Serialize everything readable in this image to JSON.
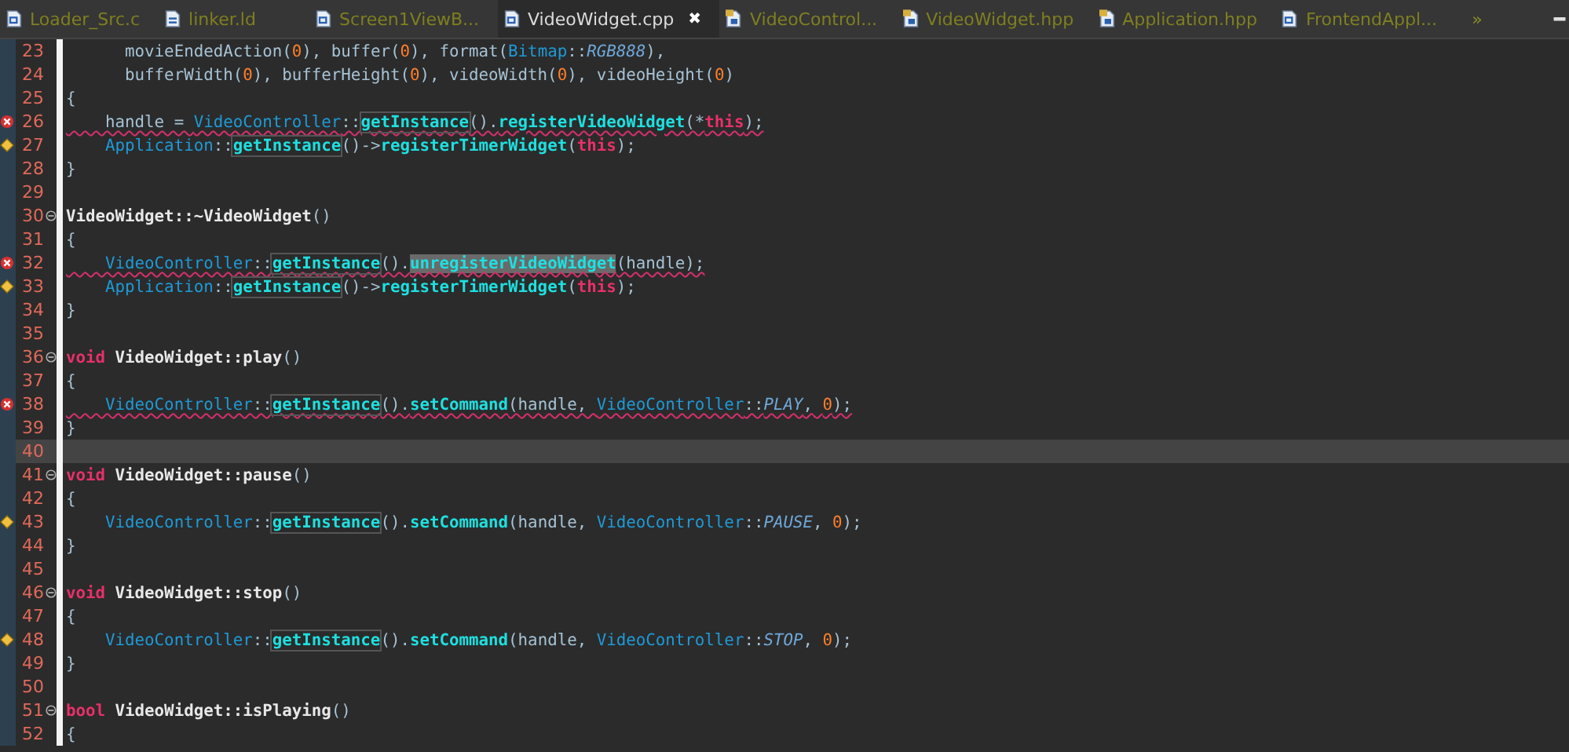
{
  "tabs": [
    {
      "label": "Loader_Src.c",
      "kind": "source",
      "selected": false
    },
    {
      "label": "linker.ld",
      "kind": "linker",
      "selected": false
    },
    {
      "label": "Screen1ViewB...",
      "kind": "source",
      "selected": false
    },
    {
      "label": "VideoWidget.cpp",
      "kind": "source",
      "selected": true,
      "close": "✖"
    },
    {
      "label": "VideoControl...",
      "kind": "header",
      "selected": false
    },
    {
      "label": "VideoWidget.hpp",
      "kind": "header",
      "selected": false
    },
    {
      "label": "Application.hpp",
      "kind": "header",
      "selected": false
    },
    {
      "label": "FrontendAppl...",
      "kind": "source",
      "selected": false
    }
  ],
  "tab_overflow": "»",
  "lines": [
    {
      "number": "23",
      "kind": "normal",
      "foldable": false,
      "current": false,
      "squiggle": false,
      "tokens": [
        {
          "kind": "plain",
          "text": "      movieEndedAction("
        },
        {
          "kind": "num",
          "text": "0"
        },
        {
          "kind": "plain",
          "text": "), buffer("
        },
        {
          "kind": "num",
          "text": "0"
        },
        {
          "kind": "plain",
          "text": "), format("
        },
        {
          "kind": "cls",
          "text": "Bitmap"
        },
        {
          "kind": "plain",
          "text": "::"
        },
        {
          "kind": "const",
          "text": "RGB888"
        },
        {
          "kind": "plain",
          "text": "),"
        }
      ]
    },
    {
      "number": "24",
      "kind": "normal",
      "foldable": false,
      "current": false,
      "squiggle": false,
      "tokens": [
        {
          "kind": "plain",
          "text": "      bufferWidth("
        },
        {
          "kind": "num",
          "text": "0"
        },
        {
          "kind": "plain",
          "text": "), bufferHeight("
        },
        {
          "kind": "num",
          "text": "0"
        },
        {
          "kind": "plain",
          "text": "), videoWidth("
        },
        {
          "kind": "num",
          "text": "0"
        },
        {
          "kind": "plain",
          "text": "), videoHeight("
        },
        {
          "kind": "num",
          "text": "0"
        },
        {
          "kind": "plain",
          "text": ")"
        }
      ]
    },
    {
      "number": "25",
      "kind": "normal",
      "foldable": false,
      "current": false,
      "squiggle": false,
      "tokens": [
        {
          "kind": "plain",
          "text": "{"
        }
      ]
    },
    {
      "number": "26",
      "kind": "error",
      "foldable": false,
      "current": false,
      "squiggle": true,
      "tokens": [
        {
          "kind": "plain",
          "text": "    handle = "
        },
        {
          "kind": "cls",
          "text": "VideoController"
        },
        {
          "kind": "plain",
          "text": "::"
        },
        {
          "kind": "match",
          "text": "getInstance"
        },
        {
          "kind": "plain",
          "text": "()."
        },
        {
          "kind": "fn",
          "text": "registerVideoWidget"
        },
        {
          "kind": "plain",
          "text": "(*"
        },
        {
          "kind": "kw",
          "text": "this"
        },
        {
          "kind": "plain",
          "text": ");"
        }
      ]
    },
    {
      "number": "27",
      "kind": "warning",
      "foldable": false,
      "current": false,
      "squiggle": false,
      "tokens": [
        {
          "kind": "cls",
          "text": "    Application"
        },
        {
          "kind": "plain",
          "text": "::"
        },
        {
          "kind": "match",
          "text": "getInstance"
        },
        {
          "kind": "plain",
          "text": "()->"
        },
        {
          "kind": "fn",
          "text": "registerTimerWidget"
        },
        {
          "kind": "plain",
          "text": "("
        },
        {
          "kind": "kw",
          "text": "this"
        },
        {
          "kind": "plain",
          "text": ");"
        }
      ]
    },
    {
      "number": "28",
      "kind": "normal",
      "foldable": false,
      "current": false,
      "squiggle": false,
      "tokens": [
        {
          "kind": "plain",
          "text": "}"
        }
      ]
    },
    {
      "number": "29",
      "kind": "normal",
      "foldable": false,
      "current": false,
      "squiggle": false
    },
    {
      "number": "30",
      "kind": "normal",
      "foldable": true,
      "current": false,
      "squiggle": false,
      "tokens": [
        {
          "kind": "def",
          "text": "VideoWidget::~VideoWidget"
        },
        {
          "kind": "plain",
          "text": "()"
        }
      ]
    },
    {
      "number": "31",
      "kind": "normal",
      "foldable": false,
      "current": false,
      "squiggle": false,
      "tokens": [
        {
          "kind": "plain",
          "text": "{"
        }
      ]
    },
    {
      "number": "32",
      "kind": "error",
      "foldable": false,
      "current": false,
      "squiggle": true,
      "tokens": [
        {
          "kind": "cls",
          "text": "    VideoController"
        },
        {
          "kind": "plain",
          "text": "::"
        },
        {
          "kind": "match",
          "text": "getInstance"
        },
        {
          "kind": "plain",
          "text": "()."
        },
        {
          "kind": "sel",
          "text": "unregisterVideoWidget"
        },
        {
          "kind": "plain",
          "text": "(handle);"
        }
      ]
    },
    {
      "number": "33",
      "kind": "warning",
      "foldable": false,
      "current": false,
      "squiggle": false,
      "tokens": [
        {
          "kind": "cls",
          "text": "    Application"
        },
        {
          "kind": "plain",
          "text": "::"
        },
        {
          "kind": "match",
          "text": "getInstance"
        },
        {
          "kind": "plain",
          "text": "()->"
        },
        {
          "kind": "fn",
          "text": "registerTimerWidget"
        },
        {
          "kind": "plain",
          "text": "("
        },
        {
          "kind": "kw",
          "text": "this"
        },
        {
          "kind": "plain",
          "text": ");"
        }
      ]
    },
    {
      "number": "34",
      "kind": "normal",
      "foldable": false,
      "current": false,
      "squiggle": false,
      "tokens": [
        {
          "kind": "plain",
          "text": "}"
        }
      ]
    },
    {
      "number": "35",
      "kind": "normal",
      "foldable": false,
      "current": false,
      "squiggle": false
    },
    {
      "number": "36",
      "kind": "normal",
      "foldable": true,
      "current": false,
      "squiggle": false,
      "tokens": [
        {
          "kind": "kw",
          "text": "void "
        },
        {
          "kind": "def",
          "text": "VideoWidget::play"
        },
        {
          "kind": "plain",
          "text": "()"
        }
      ]
    },
    {
      "number": "37",
      "kind": "normal",
      "foldable": false,
      "current": false,
      "squiggle": false,
      "tokens": [
        {
          "kind": "plain",
          "text": "{"
        }
      ]
    },
    {
      "number": "38",
      "kind": "error",
      "foldable": false,
      "current": false,
      "squiggle": true,
      "tokens": [
        {
          "kind": "cls",
          "text": "    VideoController"
        },
        {
          "kind": "plain",
          "text": "::"
        },
        {
          "kind": "match",
          "text": "getInstance"
        },
        {
          "kind": "plain",
          "text": "()."
        },
        {
          "kind": "fn",
          "text": "setCommand"
        },
        {
          "kind": "plain",
          "text": "(handle, "
        },
        {
          "kind": "cls",
          "text": "VideoController"
        },
        {
          "kind": "plain",
          "text": "::"
        },
        {
          "kind": "const",
          "text": "PLAY"
        },
        {
          "kind": "plain",
          "text": ", "
        },
        {
          "kind": "num",
          "text": "0"
        },
        {
          "kind": "plain",
          "text": ");"
        }
      ]
    },
    {
      "number": "39",
      "kind": "normal",
      "foldable": false,
      "current": false,
      "squiggle": false,
      "tokens": [
        {
          "kind": "plain",
          "text": "}"
        }
      ]
    },
    {
      "number": "40",
      "kind": "normal",
      "foldable": false,
      "current": true,
      "squiggle": false
    },
    {
      "number": "41",
      "kind": "normal",
      "foldable": true,
      "current": false,
      "squiggle": false,
      "tokens": [
        {
          "kind": "kw",
          "text": "void "
        },
        {
          "kind": "def",
          "text": "VideoWidget::pause"
        },
        {
          "kind": "plain",
          "text": "()"
        }
      ]
    },
    {
      "number": "42",
      "kind": "normal",
      "foldable": false,
      "current": false,
      "squiggle": false,
      "tokens": [
        {
          "kind": "plain",
          "text": "{"
        }
      ]
    },
    {
      "number": "43",
      "kind": "warning",
      "foldable": false,
      "current": false,
      "squiggle": false,
      "tokens": [
        {
          "kind": "cls",
          "text": "    VideoController"
        },
        {
          "kind": "plain",
          "text": "::"
        },
        {
          "kind": "match",
          "text": "getInstance"
        },
        {
          "kind": "plain",
          "text": "()."
        },
        {
          "kind": "fn",
          "text": "setCommand"
        },
        {
          "kind": "plain",
          "text": "(handle, "
        },
        {
          "kind": "cls",
          "text": "VideoController"
        },
        {
          "kind": "plain",
          "text": "::"
        },
        {
          "kind": "const",
          "text": "PAUSE"
        },
        {
          "kind": "plain",
          "text": ", "
        },
        {
          "kind": "num",
          "text": "0"
        },
        {
          "kind": "plain",
          "text": ");"
        }
      ]
    },
    {
      "number": "44",
      "kind": "normal",
      "foldable": false,
      "current": false,
      "squiggle": false,
      "tokens": [
        {
          "kind": "plain",
          "text": "}"
        }
      ]
    },
    {
      "number": "45",
      "kind": "normal",
      "foldable": false,
      "current": false,
      "squiggle": false
    },
    {
      "number": "46",
      "kind": "normal",
      "foldable": true,
      "current": false,
      "squiggle": false,
      "tokens": [
        {
          "kind": "kw",
          "text": "void "
        },
        {
          "kind": "def",
          "text": "VideoWidget::stop"
        },
        {
          "kind": "plain",
          "text": "()"
        }
      ]
    },
    {
      "number": "47",
      "kind": "normal",
      "foldable": false,
      "current": false,
      "squiggle": false,
      "tokens": [
        {
          "kind": "plain",
          "text": "{"
        }
      ]
    },
    {
      "number": "48",
      "kind": "warning",
      "foldable": false,
      "current": false,
      "squiggle": false,
      "tokens": [
        {
          "kind": "cls",
          "text": "    VideoController"
        },
        {
          "kind": "plain",
          "text": "::"
        },
        {
          "kind": "match",
          "text": "getInstance"
        },
        {
          "kind": "plain",
          "text": "()."
        },
        {
          "kind": "fn",
          "text": "setCommand"
        },
        {
          "kind": "plain",
          "text": "(handle, "
        },
        {
          "kind": "cls",
          "text": "VideoController"
        },
        {
          "kind": "plain",
          "text": "::"
        },
        {
          "kind": "const",
          "text": "STOP"
        },
        {
          "kind": "plain",
          "text": ", "
        },
        {
          "kind": "num",
          "text": "0"
        },
        {
          "kind": "plain",
          "text": ");"
        }
      ]
    },
    {
      "number": "49",
      "kind": "normal",
      "foldable": false,
      "current": false,
      "squiggle": false,
      "tokens": [
        {
          "kind": "plain",
          "text": "}"
        }
      ]
    },
    {
      "number": "50",
      "kind": "normal",
      "foldable": false,
      "current": false,
      "squiggle": false
    },
    {
      "number": "51",
      "kind": "normal",
      "foldable": true,
      "current": false,
      "squiggle": false,
      "tokens": [
        {
          "kind": "kw",
          "text": "bool "
        },
        {
          "kind": "def",
          "text": "VideoWidget::isPlaying"
        },
        {
          "kind": "plain",
          "text": "()"
        }
      ]
    },
    {
      "number": "52",
      "kind": "normal",
      "foldable": false,
      "current": false,
      "squiggle": false,
      "tokens": [
        {
          "kind": "plain",
          "text": "{"
        }
      ]
    }
  ]
}
